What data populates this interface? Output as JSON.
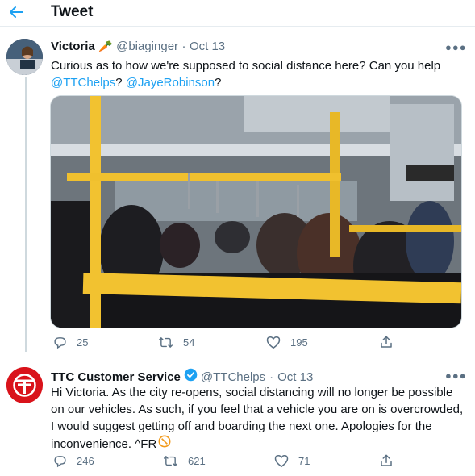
{
  "header": {
    "title": "Tweet"
  },
  "tweet1": {
    "name": "Victoria",
    "name_emoji": "🥕",
    "handle": "@biaginger",
    "sep": "·",
    "date": "Oct 13",
    "text_line1": "Curious as to how we're supposed to social distance here? Can you help",
    "mention1": "@TTChelps",
    "q": "?",
    "mention2": "@JayeRobinson",
    "q2": "?",
    "replies": "25",
    "retweets": "54",
    "likes": "195"
  },
  "tweet2": {
    "name": "TTC Customer Service",
    "handle": "@TTChelps",
    "sep": "·",
    "date": "Oct 13",
    "lines": [
      "Hi Victoria. As the city re-opens, social distancing will no longer be possible",
      "on our vehicles. As such, if you feel that a vehicle you are on is overcrowded,",
      "I would suggest getting off and boarding the next one. Apologies for the",
      "inconvenience. ^FR"
    ],
    "replies": "246",
    "retweets": "621",
    "likes": "71"
  },
  "colors": {
    "accent": "#1da1f2",
    "muted": "#5b7083",
    "divider": "#e6ecf0",
    "ttc_red": "#d9131b",
    "bus_yellow": "#f2c230"
  },
  "icons": [
    "back-arrow-icon",
    "more-icon",
    "reply-icon",
    "retweet-icon",
    "like-icon",
    "share-icon",
    "verified-badge-icon",
    "carrot-emoji",
    "no-entry-emoji"
  ]
}
